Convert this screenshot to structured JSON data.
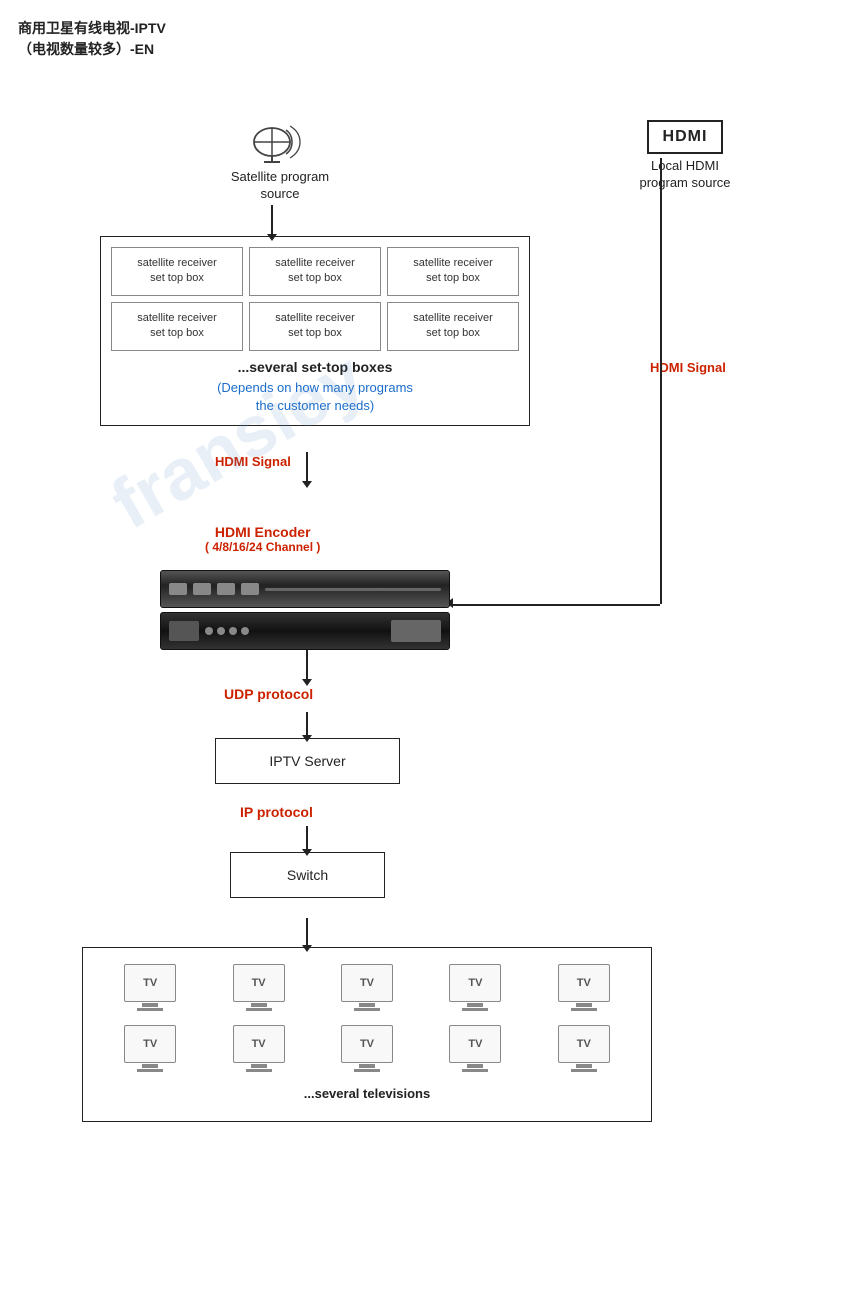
{
  "title": {
    "line1": "商用卫星有线电视-IPTV",
    "line2": "（电视数量较多）-EN"
  },
  "satellite": {
    "label": "Satellite program\nsource"
  },
  "hdmi_source": {
    "box_label": "HDMI",
    "label": "Local HDMI\nprogram source"
  },
  "stb": {
    "cells": [
      "satellite receiver\nset top box",
      "satellite receiver\nset top box",
      "satellite receiver\nset top box",
      "satellite receiver\nset top box",
      "satellite receiver\nset top box",
      "satellite receiver\nset top box"
    ],
    "label_bold": "...several set-top boxes",
    "label_blue": "(Depends on how many programs\nthe customer needs)"
  },
  "hdmi_signal_left": "HDMI Signal",
  "hdmi_signal_right": "HDMI Signal",
  "hdmi_encoder": {
    "label": "HDMI Encoder",
    "sub": "( 4/8/16/24 Channel )"
  },
  "udp_protocol": "UDP protocol",
  "iptv_server": "IPTV Server",
  "ip_protocol": "IP protocol",
  "switch": "Switch",
  "tv": {
    "label": "TV",
    "count": 10,
    "footer": "...several televisions"
  }
}
